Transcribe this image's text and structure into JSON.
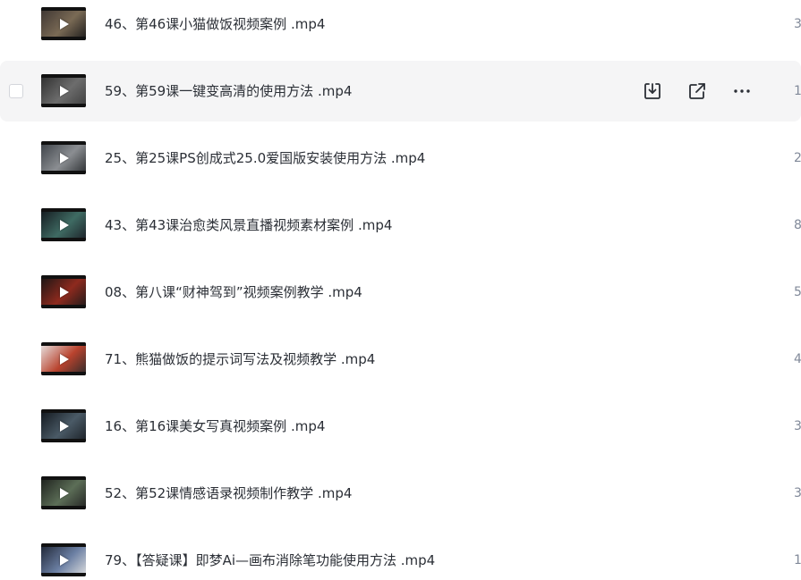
{
  "files": [
    {
      "name": "46、第46课小猫做饭视频案例 .mp4",
      "size": "3",
      "thumb_colors": [
        "#3b3330",
        "#7a6a55",
        "#1a1a1a"
      ]
    },
    {
      "name": "59、第59课一键变高清的使用方法 .mp4",
      "size": "1",
      "thumb_colors": [
        "#2c2c2c",
        "#6d6d6d",
        "#3d3d3d"
      ],
      "hovered": true
    },
    {
      "name": "25、第25课PS创成式25.0爱国版安装使用方法 .mp4",
      "size": "2",
      "thumb_colors": [
        "#3a3f45",
        "#8b8e92",
        "#2a2d30"
      ]
    },
    {
      "name": "43、第43课治愈类风景直播视频素材案例 .mp4",
      "size": "8",
      "thumb_colors": [
        "#12161c",
        "#3f6b63",
        "#1b1f26"
      ]
    },
    {
      "name": "08、第八课“财神驾到”视频案例教学 .mp4",
      "size": "5",
      "thumb_colors": [
        "#141414",
        "#8e2a1e",
        "#1a1a1a"
      ]
    },
    {
      "name": "71、熊猫做饭的提示词写法及视频教学 .mp4",
      "size": "4",
      "thumb_colors": [
        "#e9e9e9",
        "#b9432e",
        "#2a2a2a"
      ]
    },
    {
      "name": "16、第16课美女写真视频案例 .mp4",
      "size": "3",
      "thumb_colors": [
        "#10151b",
        "#4a5a66",
        "#1a1f25"
      ]
    },
    {
      "name": "52、第52课情感语录视频制作教学 .mp4",
      "size": "3",
      "thumb_colors": [
        "#1a1d1a",
        "#5c6e57",
        "#222"
      ]
    },
    {
      "name": "79、【答疑课】即梦Ai—画布消除笔功能使用方法 .mp4",
      "size": "1",
      "thumb_colors": [
        "#1c2230",
        "#6b7fa3",
        "#e0e0e0"
      ]
    }
  ],
  "actions": {
    "download_icon": "download-icon",
    "share_icon": "share-icon",
    "more_icon": "more-icon"
  },
  "colors": {
    "hover_bg": "#f5f5f6",
    "text": "#2b2f36",
    "muted": "#818999",
    "icon": "#2b2f36"
  }
}
